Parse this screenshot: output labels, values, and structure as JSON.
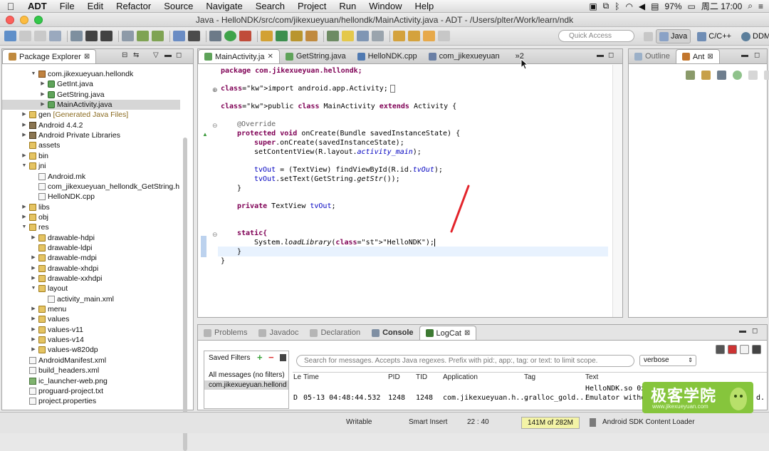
{
  "menubar": {
    "app": "ADT",
    "items": [
      "File",
      "Edit",
      "Refactor",
      "Source",
      "Navigate",
      "Search",
      "Project",
      "Run",
      "Window",
      "Help"
    ],
    "battery": "97%",
    "clock": "周二 17:00"
  },
  "window": {
    "title": "Java - HelloNDK/src/com/jikexueyuan/hellondk/MainActivity.java - ADT - /Users/plter/Work/learn/ndk"
  },
  "toolbar": {
    "quick_access_placeholder": "Quick Access",
    "perspectives": [
      "Java",
      "C/C++",
      "DDMS"
    ]
  },
  "package_explorer": {
    "tab_label": "Package Explorer",
    "rows": [
      {
        "label": "com.jikexueyuan.hellondk",
        "icon": "package-icon",
        "depth": 2,
        "expanded": true
      },
      {
        "label": "GetInt.java",
        "icon": "java-file-icon",
        "depth": 3,
        "expanded": false
      },
      {
        "label": "GetString.java",
        "icon": "java-file-icon",
        "depth": 3,
        "expanded": false
      },
      {
        "label": "MainActivity.java",
        "icon": "java-file-icon",
        "depth": 3,
        "expanded": false,
        "selected": true
      },
      {
        "label": "gen",
        "suffix": "[Generated Java Files]",
        "icon": "folder-icon",
        "depth": 1,
        "expanded": false
      },
      {
        "label": "Android 4.4.2",
        "icon": "library-icon",
        "depth": 1,
        "expanded": false
      },
      {
        "label": "Android Private Libraries",
        "icon": "library-icon",
        "depth": 1,
        "expanded": false
      },
      {
        "label": "assets",
        "icon": "folder-icon",
        "depth": 1,
        "leaf": true
      },
      {
        "label": "bin",
        "icon": "folder-icon",
        "depth": 1,
        "expanded": false
      },
      {
        "label": "jni",
        "icon": "folder-icon",
        "depth": 1,
        "expanded": true
      },
      {
        "label": "Android.mk",
        "icon": "file-icon",
        "depth": 2,
        "leaf": true
      },
      {
        "label": "com_jikexueyuan_hellondk_GetString.h",
        "icon": "file-icon",
        "depth": 2,
        "leaf": true
      },
      {
        "label": "HelloNDK.cpp",
        "icon": "file-icon",
        "depth": 2,
        "leaf": true
      },
      {
        "label": "libs",
        "icon": "folder-icon",
        "depth": 1,
        "expanded": false
      },
      {
        "label": "obj",
        "icon": "folder-icon",
        "depth": 1,
        "expanded": false
      },
      {
        "label": "res",
        "icon": "folder-icon",
        "depth": 1,
        "expanded": true
      },
      {
        "label": "drawable-hdpi",
        "icon": "folder-icon",
        "depth": 2,
        "expanded": false
      },
      {
        "label": "drawable-ldpi",
        "icon": "folder-icon",
        "depth": 2,
        "leaf": true
      },
      {
        "label": "drawable-mdpi",
        "icon": "folder-icon",
        "depth": 2,
        "expanded": false
      },
      {
        "label": "drawable-xhdpi",
        "icon": "folder-icon",
        "depth": 2,
        "expanded": false
      },
      {
        "label": "drawable-xxhdpi",
        "icon": "folder-icon",
        "depth": 2,
        "expanded": false
      },
      {
        "label": "layout",
        "icon": "folder-icon",
        "depth": 2,
        "expanded": true
      },
      {
        "label": "activity_main.xml",
        "icon": "file-icon",
        "depth": 3,
        "leaf": true
      },
      {
        "label": "menu",
        "icon": "folder-icon",
        "depth": 2,
        "expanded": false
      },
      {
        "label": "values",
        "icon": "folder-icon",
        "depth": 2,
        "expanded": false
      },
      {
        "label": "values-v11",
        "icon": "folder-icon",
        "depth": 2,
        "expanded": false
      },
      {
        "label": "values-v14",
        "icon": "folder-icon",
        "depth": 2,
        "expanded": false
      },
      {
        "label": "values-w820dp",
        "icon": "folder-icon",
        "depth": 2,
        "expanded": false
      },
      {
        "label": "AndroidManifest.xml",
        "icon": "file-icon",
        "depth": 1,
        "leaf": true
      },
      {
        "label": "build_headers.xml",
        "icon": "file-icon",
        "depth": 1,
        "leaf": true
      },
      {
        "label": "ic_launcher-web.png",
        "icon": "image-icon",
        "depth": 1,
        "leaf": true
      },
      {
        "label": "proguard-project.txt",
        "icon": "file-icon",
        "depth": 1,
        "leaf": true
      },
      {
        "label": "project.properties",
        "icon": "file-icon",
        "depth": 1,
        "leaf": true
      }
    ]
  },
  "editor": {
    "tabs": [
      {
        "label": "MainActivity.ja",
        "active": true,
        "close": "✕"
      },
      {
        "label": "GetString.java",
        "active": false
      },
      {
        "label": "HelloNDK.cpp",
        "active": false
      },
      {
        "label": "com_jikexueyuan",
        "active": false
      }
    ],
    "overflow": "»2",
    "lines": {
      "l1": [
        "package com.jikexueyuan.hellondk;"
      ],
      "l2": [
        "import android.app.Activity;"
      ],
      "l3": [
        "public class MainActivity extends Activity {"
      ],
      "l4": [
        "@Override"
      ],
      "l5": [
        "protected void onCreate(Bundle savedInstanceState) {"
      ],
      "l6": [
        "super.onCreate(savedInstanceState);"
      ],
      "l7": [
        "setContentView(R.layout.activity_main);"
      ],
      "l8": [
        "tvOut = (TextView) findViewById(R.id.tvOut);"
      ],
      "l9": [
        "tvOut.setText(GetString.getStr());"
      ],
      "l10": [
        "}"
      ],
      "l11": [
        "private TextView tvOut;"
      ],
      "l12": [
        "static{"
      ],
      "l13": [
        "System.loadLibrary(\"HelloNDK\");"
      ],
      "l14": [
        "}"
      ],
      "l15": [
        "}"
      ]
    }
  },
  "outline": {
    "tabs": [
      "Outline",
      "Ant"
    ]
  },
  "bottom": {
    "tabs": [
      "Problems",
      "Javadoc",
      "Declaration",
      "Console",
      "LogCat"
    ],
    "active_tab": "LogCat",
    "saved_filters_label": "Saved Filters",
    "filters": [
      "All messages (no filters)",
      "com.jikexueyuan.hellond"
    ],
    "search_placeholder": "Search for messages. Accepts Java regexes. Prefix with pid:, app:, tag: or text: to limit scope.",
    "level": "verbose",
    "columns": [
      "Le",
      "Time",
      "PID",
      "TID",
      "Application",
      "Tag",
      "Text"
    ],
    "rows": [
      {
        "level": "",
        "time": "",
        "pid": "",
        "tid": "",
        "app": "",
        "tag": "",
        "text": "HelloNDK.so 0x"
      },
      {
        "level": "D",
        "time": "05-13 04:48:44.532",
        "pid": "1248",
        "tid": "1248",
        "app": "com.jikexueyuan.h...",
        "tag": "gralloc_gold...",
        "text": "Emulator witho"
      }
    ],
    "text_tail": "d."
  },
  "status": {
    "writable": "Writable",
    "insert_mode": "Smart Insert",
    "position": "22 : 40",
    "heap": "141M of 282M",
    "loader": "Android SDK Content Loader"
  },
  "watermark": {
    "title": "极客学院",
    "url": "www.jikexueyuan.com"
  },
  "colors": {
    "keyword": "#7f0055",
    "string": "#2a00ff",
    "field": "#0000c0",
    "annotation": "#646464",
    "annotation_mark": "#e3242b",
    "watermark_green": "#86c53c"
  }
}
